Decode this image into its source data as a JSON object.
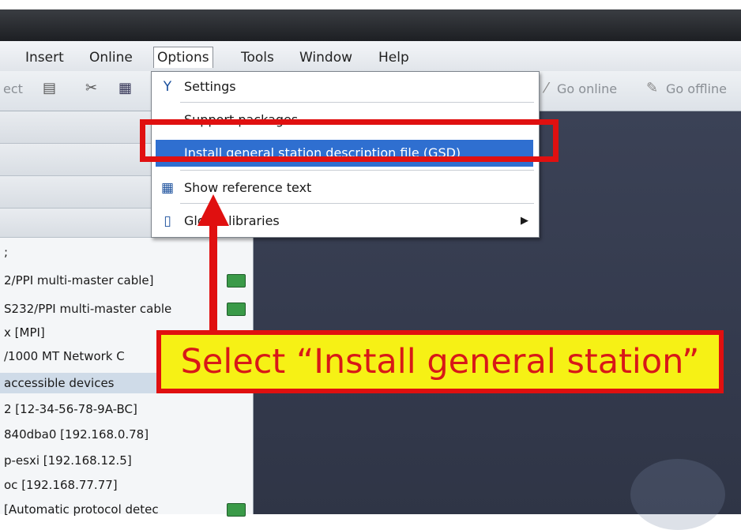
{
  "menubar": {
    "items": [
      "Insert",
      "Online",
      "Options",
      "Tools",
      "Window",
      "Help"
    ]
  },
  "toolbar": {
    "left_text": "ect",
    "go_online": "Go online",
    "go_offline": "Go offline"
  },
  "options_menu": {
    "items": [
      {
        "icon": "settings-icon",
        "label": "Settings"
      },
      {
        "icon": "",
        "label": "Support packages"
      },
      {
        "icon": "",
        "label": "Install general station description file (GSD)"
      },
      {
        "icon": "reference-text-icon",
        "label": "Show reference text"
      },
      {
        "icon": "book-icon",
        "label": "Global libraries"
      }
    ]
  },
  "left_panel": {
    "rows": [
      ";",
      "2/PPI multi-master cable]",
      "S232/PPI multi-master cable",
      "x [MPI]",
      "/1000 MT Network C",
      "accessible devices",
      "2 [12-34-56-78-9A-BC]",
      "840dba0 [192.168.0.78]",
      "p-esxi [192.168.12.5]",
      "oc [192.168.77.77]",
      "[Automatic protocol detec"
    ]
  },
  "annotation": {
    "callout_text": "Select “Install general station”",
    "highlight_color": "#e01010",
    "callout_bg": "#f6f115"
  }
}
